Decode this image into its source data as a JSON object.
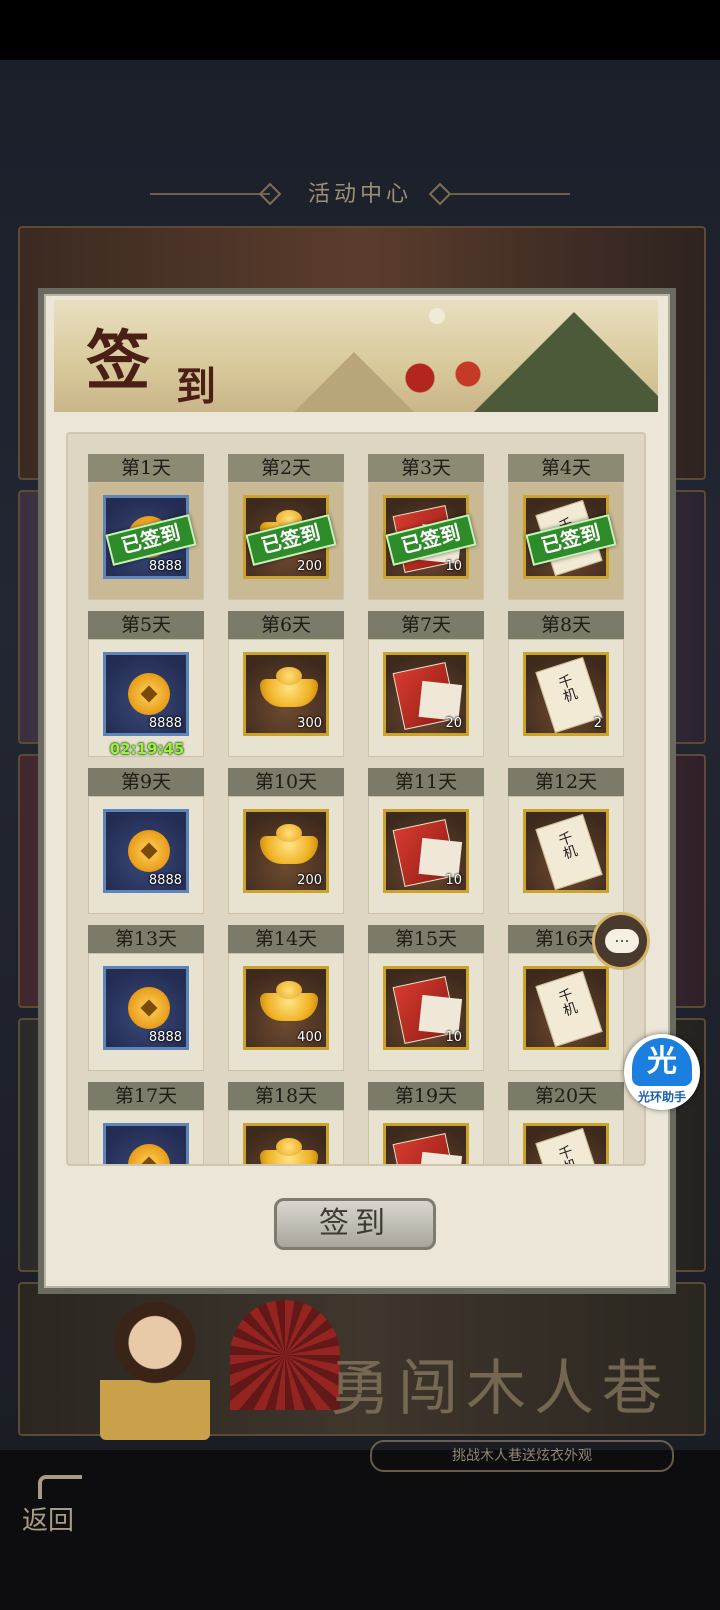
{
  "header": {
    "title": "活动中心"
  },
  "panel": {
    "title_big": "签",
    "title_small": "到",
    "sign_button": "签到"
  },
  "days": [
    {
      "label": "第1天",
      "item": "coin",
      "qty": "8888",
      "signed": true
    },
    {
      "label": "第2天",
      "item": "ingot",
      "qty": "200",
      "signed": true
    },
    {
      "label": "第3天",
      "item": "scroll",
      "qty": "10",
      "signed": true
    },
    {
      "label": "第4天",
      "item": "paper",
      "qty": "",
      "signed": true
    },
    {
      "label": "第5天",
      "item": "coin",
      "qty": "8888",
      "signed": false,
      "timer": "02:19:45"
    },
    {
      "label": "第6天",
      "item": "ingot",
      "qty": "300",
      "signed": false
    },
    {
      "label": "第7天",
      "item": "scroll",
      "qty": "20",
      "signed": false
    },
    {
      "label": "第8天",
      "item": "paper",
      "qty": "2",
      "signed": false
    },
    {
      "label": "第9天",
      "item": "coin",
      "qty": "8888",
      "signed": false
    },
    {
      "label": "第10天",
      "item": "ingot",
      "qty": "200",
      "signed": false
    },
    {
      "label": "第11天",
      "item": "scroll",
      "qty": "10",
      "signed": false
    },
    {
      "label": "第12天",
      "item": "paper",
      "qty": "",
      "signed": false
    },
    {
      "label": "第13天",
      "item": "coin",
      "qty": "8888",
      "signed": false
    },
    {
      "label": "第14天",
      "item": "ingot",
      "qty": "400",
      "signed": false
    },
    {
      "label": "第15天",
      "item": "scroll",
      "qty": "10",
      "signed": false
    },
    {
      "label": "第16天",
      "item": "paper",
      "qty": "",
      "signed": false
    },
    {
      "label": "第17天",
      "item": "coin",
      "qty": "",
      "signed": false
    },
    {
      "label": "第18天",
      "item": "ingot",
      "qty": "",
      "signed": false
    },
    {
      "label": "第19天",
      "item": "scroll",
      "qty": "",
      "signed": false
    },
    {
      "label": "第20天",
      "item": "paper",
      "qty": "",
      "signed": false
    }
  ],
  "signed_stamp": "已签到",
  "paper_text": "千机",
  "banner": {
    "title": "勇闯木人巷",
    "subtitle": "挑战木人巷送炫衣外观"
  },
  "back_label": "返回",
  "chat_icon": "...",
  "helper": {
    "glyph": "光",
    "label": "光环助手"
  }
}
